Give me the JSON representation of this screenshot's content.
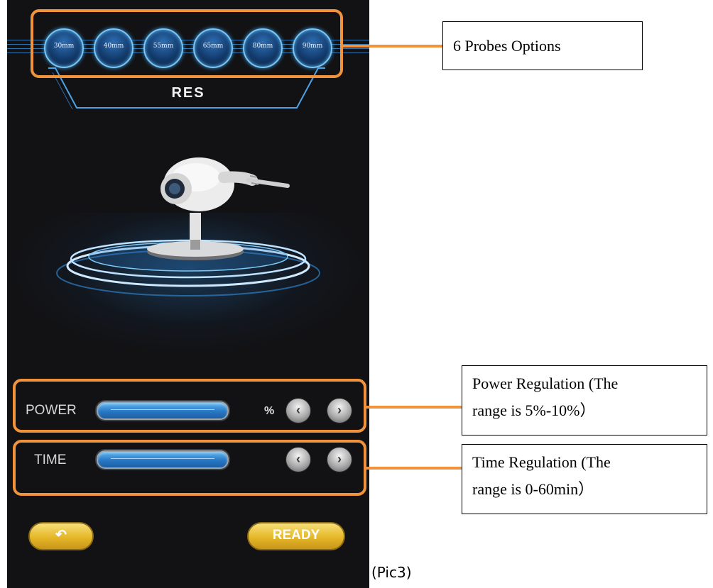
{
  "probes": {
    "options": [
      "30mm",
      "40mm",
      "55mm",
      "65mm",
      "80mm",
      "90mm"
    ]
  },
  "mode": {
    "title": "RES"
  },
  "controls": {
    "power": {
      "label": "POWER",
      "unit": "%",
      "decrease_icon": "chevron-left-icon",
      "increase_icon": "chevron-right-icon"
    },
    "time": {
      "label": "TIME",
      "decrease_icon": "chevron-left-icon",
      "increase_icon": "chevron-right-icon"
    }
  },
  "footer": {
    "back_icon": "undo-arrow-icon",
    "ready_label": "READY"
  },
  "annotations": {
    "probes_note": "6 Probes Options",
    "power_note_line1": "Power Regulation (The",
    "power_note_line2": "range is 5%-10%）",
    "time_note_line1": "Time Regulation (The",
    "time_note_line2": "range is 0-60min）",
    "caption": "(Pic3)"
  },
  "colors": {
    "annotation_orange": "#f0933c",
    "bar_blue": "#2878c4",
    "gold_button": "#e5b728",
    "screen_background": "#121214"
  }
}
